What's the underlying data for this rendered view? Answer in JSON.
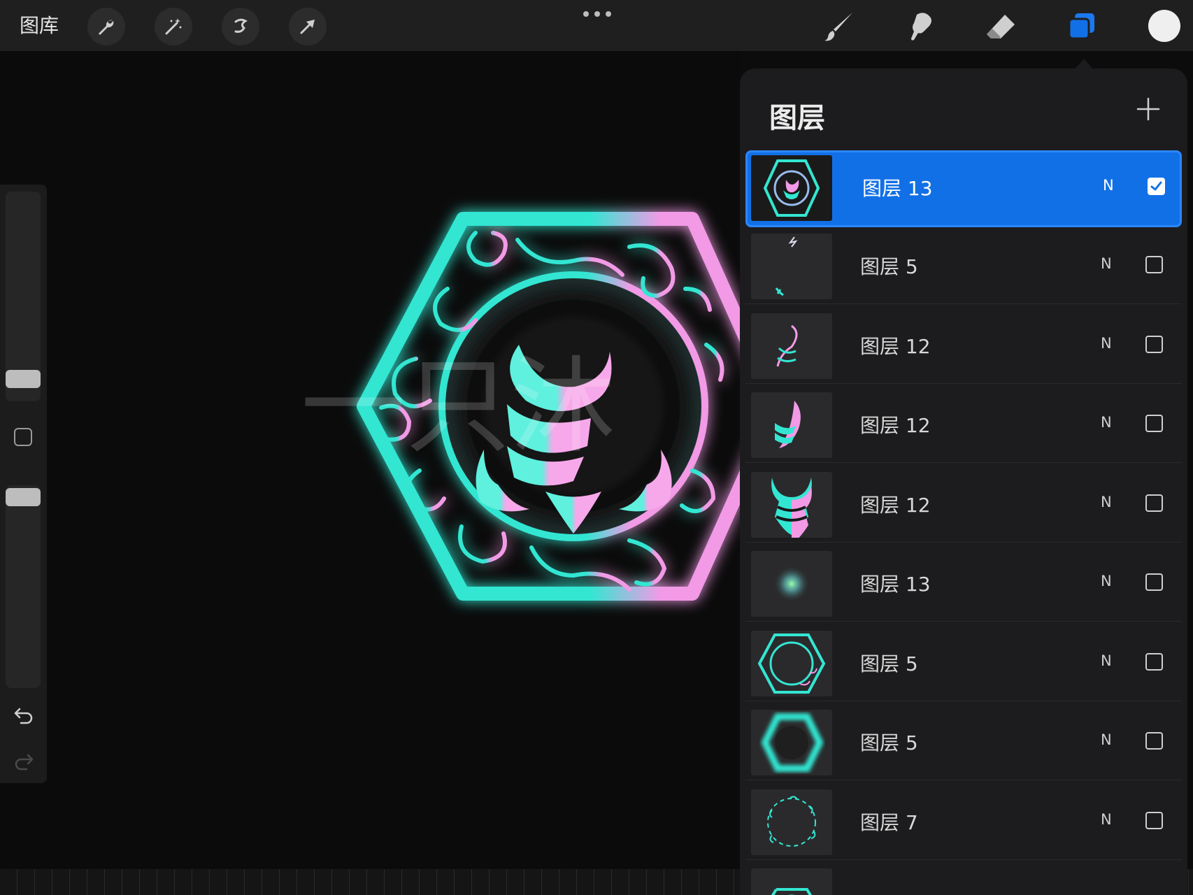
{
  "toolbar": {
    "gallery_label": "图库",
    "left_tools": [
      "wrench-icon",
      "magic-wand-icon",
      "selection-icon",
      "transform-arrow-icon"
    ],
    "right_tools": [
      "brush-icon",
      "smudge-icon",
      "eraser-icon",
      "layers-icon"
    ],
    "active_tool": "layers-icon",
    "current_color": "#efefef"
  },
  "canvas": {
    "watermark": "一只沐"
  },
  "layers_panel": {
    "title": "图层",
    "layers": [
      {
        "name": "图层 13",
        "blend": "N",
        "visible": true,
        "active": true
      },
      {
        "name": "图层 5",
        "blend": "N",
        "visible": false,
        "active": false
      },
      {
        "name": "图层 12",
        "blend": "N",
        "visible": false,
        "active": false
      },
      {
        "name": "图层 12",
        "blend": "N",
        "visible": false,
        "active": false
      },
      {
        "name": "图层 12",
        "blend": "N",
        "visible": false,
        "active": false
      },
      {
        "name": "图层 13",
        "blend": "N",
        "visible": false,
        "active": false
      },
      {
        "name": "图层 5",
        "blend": "N",
        "visible": false,
        "active": false
      },
      {
        "name": "图层 5",
        "blend": "N",
        "visible": false,
        "active": false
      },
      {
        "name": "图层 7",
        "blend": "N",
        "visible": false,
        "active": false
      }
    ]
  },
  "colors": {
    "accent": "#1270e6",
    "neon_cyan": "#33e6d2",
    "neon_pink": "#f29ae6"
  }
}
